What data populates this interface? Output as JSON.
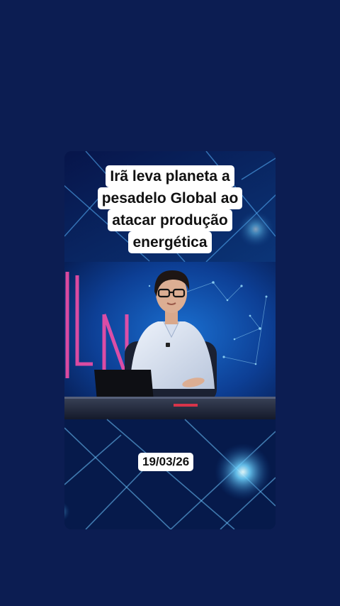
{
  "colors": {
    "page_background": "#0c1d52",
    "studio_blue": "#0a3f8a",
    "caption_background": "#ffffff",
    "caption_text": "#111111"
  },
  "video": {
    "headline_lines": [
      "Irã leva planeta a",
      "pesadelo Global ao",
      "atacar produção",
      "energética"
    ],
    "date_label": "19/03/26"
  }
}
